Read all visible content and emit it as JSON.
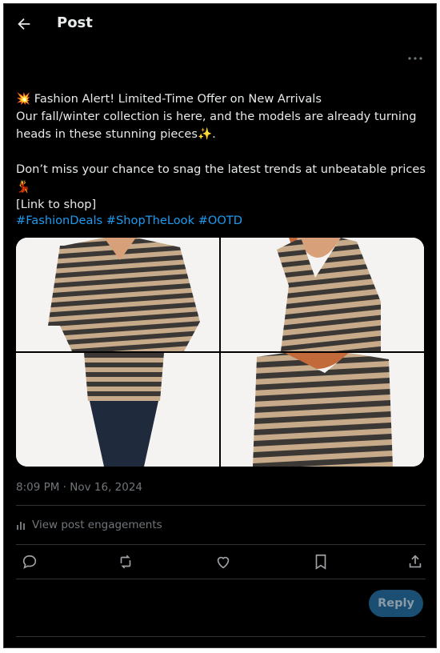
{
  "header": {
    "title": "Post"
  },
  "post": {
    "line1": "💥 Fashion Alert! Limited-Time Offer on New Arrivals",
    "line2": "Our fall/winter collection is here, and the models are already turning",
    "line3": "heads in these stunning pieces✨.",
    "line4": "Don’t miss your chance to snag the latest trends at unbeatable prices 💃",
    "line5": "[Link to shop]",
    "hashtags": [
      "#FashionDeals",
      "#ShopTheLook",
      "#OOTD"
    ],
    "timestamp": "8:09 PM · Nov 16, 2024",
    "engagements_label": "View post engagements"
  },
  "actions": {
    "reply_button_label": "Reply"
  },
  "icons": [
    "back-arrow-icon",
    "more-icon",
    "analytics-icon",
    "comment-icon",
    "repost-icon",
    "like-icon",
    "bookmark-icon",
    "share-icon"
  ],
  "colors": {
    "background": "#000000",
    "text": "#e7e9ea",
    "link": "#1d9bf0",
    "muted": "#71767b",
    "reply_button": "#1a4f73"
  }
}
